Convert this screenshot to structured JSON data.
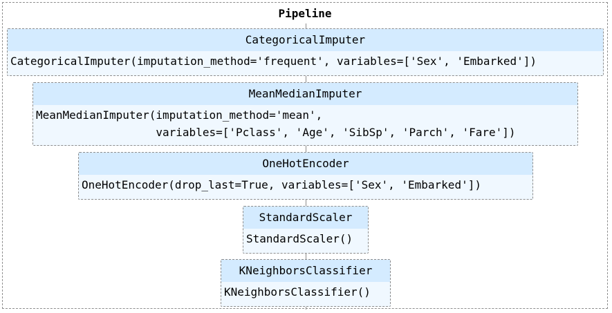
{
  "pipeline": {
    "title": "Pipeline",
    "steps": [
      {
        "name": "CategoricalImputer",
        "params": "CategoricalImputer(imputation_method='frequent', variables=['Sex', 'Embarked'])"
      },
      {
        "name": "MeanMedianImputer",
        "params": "MeanMedianImputer(imputation_method='mean',\n                  variables=['Pclass', 'Age', 'SibSp', 'Parch', 'Fare'])"
      },
      {
        "name": "OneHotEncoder",
        "params": "OneHotEncoder(drop_last=True, variables=['Sex', 'Embarked'])"
      },
      {
        "name": "StandardScaler",
        "params": "StandardScaler()"
      },
      {
        "name": "KNeighborsClassifier",
        "params": "KNeighborsClassifier()"
      }
    ]
  },
  "colors": {
    "header_bg": "#d4ebff",
    "body_bg": "#f0f8ff",
    "border": "#8c8c8c"
  }
}
